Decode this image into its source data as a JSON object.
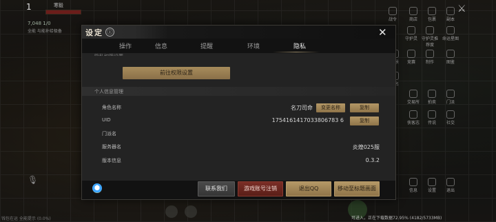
{
  "hud": {
    "level": "1",
    "player_name": "寒毅",
    "stats": "7,048  1/0",
    "tag": "全能 与能补给极备",
    "bottom_left_text": "钱包在运 全能提示 (0.0%)",
    "bottom_right_text": "可进入，正在下载数据72.95% (4182/5733MB)",
    "right_icons": [
      {
        "label": "战令"
      },
      {
        "label": "商店"
      },
      {
        "label": "包裹"
      },
      {
        "label": "副本"
      },
      {
        "label": "守护灵"
      },
      {
        "label": "守护灵推荐度"
      },
      {
        "label": "命运星图"
      },
      {
        "label": "风景"
      },
      {
        "label": "竞赛"
      },
      {
        "label": "制作"
      },
      {
        "label": "图鉴"
      },
      {
        "label": "排名"
      },
      {
        "label": "交易所"
      },
      {
        "label": "拍卖"
      },
      {
        "label": "门派"
      },
      {
        "label": "侠客志"
      },
      {
        "label": "传说"
      },
      {
        "label": "社交"
      },
      {
        "label": "信息"
      },
      {
        "label": "设置"
      },
      {
        "label": "退出"
      }
    ]
  },
  "dialog": {
    "title": "设定",
    "info_icon": "ⓘ",
    "close_icon": "✕",
    "tabs": [
      {
        "label": "操作"
      },
      {
        "label": "信息"
      },
      {
        "label": "提醒"
      },
      {
        "label": "环境"
      },
      {
        "label": "隐私"
      }
    ],
    "active_tab": "隐私",
    "clipped_section": "隐私权限设置",
    "permission_button": "前往权限设置",
    "personal_section": "个人信息管理",
    "rows": {
      "role_name": {
        "label": "角色名称",
        "value": "名刀司命",
        "btn_change": "变更名称",
        "btn_copy": "复制"
      },
      "uid": {
        "label": "UID",
        "value": "1754161417033806783 6",
        "btn_copy": "复制"
      },
      "guild": {
        "label": "门派名",
        "value": ""
      },
      "server": {
        "label": "服务器名",
        "value": "炎煌025服"
      },
      "version": {
        "label": "版本信息",
        "value": "0.3.2"
      }
    },
    "footer": {
      "contact": "联系我们",
      "deregister": "游戏账号注销",
      "logout_qq": "退出QQ",
      "to_title": "移动至标题画面"
    }
  },
  "colors": {
    "gold_button": "#a78c5c",
    "red_button": "#7a2e26",
    "dialog_bg": "#121212",
    "content_bg": "#232323"
  }
}
